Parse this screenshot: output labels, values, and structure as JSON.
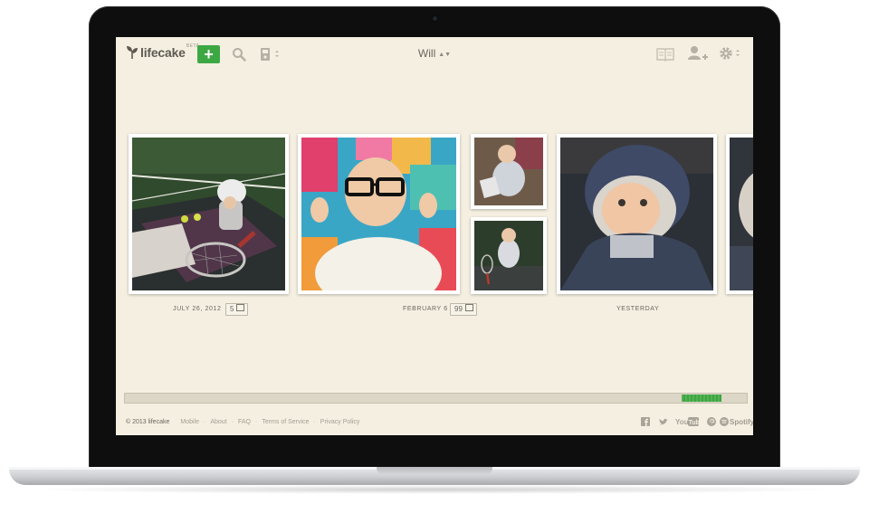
{
  "app": {
    "brand": "lifecake",
    "beta_label": "BETA",
    "add_label": "+",
    "user_name": "Will"
  },
  "topbar_icons": [
    "search-icon",
    "camera-icon",
    "book-icon",
    "add-person-icon",
    "gear-icon"
  ],
  "timeline": {
    "groups": [
      {
        "date": "JULY 26, 2012",
        "count": "5"
      },
      {
        "date": "FEBRUARY 6",
        "count": "99"
      },
      {
        "date": "YESTERDAY"
      }
    ],
    "scroll_position": 0.95
  },
  "footer": {
    "copyright": "© 2013 lifecake",
    "links": [
      "Mobile",
      "About",
      "FAQ",
      "Terms of Service",
      "Privacy Policy"
    ],
    "social": {
      "spotify": "Spotify"
    }
  },
  "colors": {
    "accent_green": "#3da843",
    "screen_bg": "#f4efe1"
  }
}
